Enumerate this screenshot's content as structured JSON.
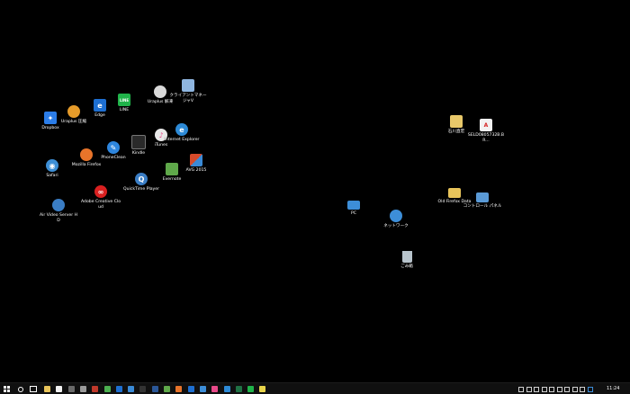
{
  "desktop": {
    "icons": [
      {
        "label": "Dropbox",
        "icon": "dropbox-icon",
        "color": "#2b7de9"
      },
      {
        "label": "Uraplus 圧縮",
        "icon": "uraplus-compress-icon",
        "color": "#e59b2a"
      },
      {
        "label": "Edge",
        "icon": "edge-icon",
        "color": "#1e6fd1"
      },
      {
        "label": "LINE",
        "icon": "line-icon",
        "color": "#20b34a"
      },
      {
        "label": "Uraplus 解凍",
        "icon": "uraplus-extract-icon",
        "color": "#d9d9d9"
      },
      {
        "label": "クライアントマネージャV",
        "icon": "client-manager-icon",
        "color": "#8fb6e0"
      },
      {
        "label": "Safari",
        "icon": "safari-icon",
        "color": "#3d8fd6"
      },
      {
        "label": "Mozilla Firefox",
        "icon": "firefox-icon",
        "color": "#e8742a"
      },
      {
        "label": "PhoneClean",
        "icon": "phoneclean-icon",
        "color": "#2e86de"
      },
      {
        "label": "Kindle",
        "icon": "kindle-icon",
        "color": "#2a2a2a"
      },
      {
        "label": "iTunes",
        "icon": "itunes-icon",
        "color": "#e8e8e8"
      },
      {
        "label": "Internet Explorer",
        "icon": "internet-explorer-icon",
        "color": "#2d8ad6"
      },
      {
        "label": "Evernote",
        "icon": "evernote-icon",
        "color": "#5fa84a"
      },
      {
        "label": "AVG 2015",
        "icon": "avg-icon",
        "color": "#d64a2a"
      },
      {
        "label": "Adobe Creative Cloud",
        "icon": "adobe-creative-cloud-icon",
        "color": "#d92020"
      },
      {
        "label": "QuickTime Player",
        "icon": "quicktime-icon",
        "color": "#3a7dc4"
      },
      {
        "label": "Air Video Server HD",
        "icon": "air-video-server-icon",
        "color": "#3a7dc4"
      },
      {
        "label": "石川直宏",
        "icon": "user-folder-icon",
        "color": "#e8c86a"
      },
      {
        "label": "SELD0805732B.BR...",
        "icon": "pdf-file-icon",
        "color": "#d62828"
      },
      {
        "label": "PC",
        "icon": "this-pc-icon",
        "color": "#3d8ed8"
      },
      {
        "label": "Old Firefox Data",
        "icon": "folder-icon",
        "color": "#e8c45a"
      },
      {
        "label": "コントロール パネル",
        "icon": "control-panel-icon",
        "color": "#5a9ad6"
      },
      {
        "label": "ネットワーク",
        "icon": "network-icon",
        "color": "#3d8ed8"
      },
      {
        "label": "ごみ箱",
        "icon": "recycle-bin-icon",
        "color": "#b8c4cc"
      }
    ]
  },
  "taskbar": {
    "start_icon": "windows-start-icon",
    "search_icon": "search-icon",
    "taskview_icon": "task-view-icon",
    "pinned": [
      {
        "icon": "file-explorer-icon",
        "color": "#e8c45a"
      },
      {
        "icon": "store-icon",
        "color": "#f2f2f2"
      },
      {
        "icon": "calculator-icon",
        "color": "#6a6a6a"
      },
      {
        "icon": "settings-icon",
        "color": "#9a9a9a"
      },
      {
        "icon": "app-red-icon",
        "color": "#c0392b"
      },
      {
        "icon": "chrome-icon",
        "color": "#4caf50"
      },
      {
        "icon": "outlook-icon",
        "color": "#1e6fd1"
      },
      {
        "icon": "mail-icon",
        "color": "#3a8ad6"
      },
      {
        "icon": "terminal-icon",
        "color": "#333333"
      },
      {
        "icon": "word-icon",
        "color": "#2b5797"
      },
      {
        "icon": "evernote-icon",
        "color": "#5fa84a"
      },
      {
        "icon": "firefox-icon",
        "color": "#e8742a"
      },
      {
        "icon": "edge-icon",
        "color": "#1e6fd1"
      },
      {
        "icon": "app-blue-icon",
        "color": "#3d8ed8"
      },
      {
        "icon": "itunes-icon",
        "color": "#e84a8a"
      },
      {
        "icon": "photos-icon",
        "color": "#2d8ad6"
      },
      {
        "icon": "excel-icon",
        "color": "#207245"
      },
      {
        "icon": "line-icon",
        "color": "#20b34a"
      },
      {
        "icon": "notes-icon",
        "color": "#e8d44a"
      }
    ],
    "tray": [
      {
        "icon": "chevron-up-icon",
        "color": "#d0d0d0"
      },
      {
        "icon": "dropbox-tray-icon",
        "color": "#d0d0d0"
      },
      {
        "icon": "onedrive-icon",
        "color": "#d0d0d0"
      },
      {
        "icon": "network-tray-icon",
        "color": "#d0d0d0"
      },
      {
        "icon": "power-icon",
        "color": "#d0d0d0"
      },
      {
        "icon": "volume-icon",
        "color": "#d0d0d0"
      },
      {
        "icon": "keyboard-icon",
        "color": "#d0d0d0"
      },
      {
        "icon": "notification-icon",
        "color": "#d0d0d0"
      },
      {
        "icon": "ime-icon",
        "color": "#d0d0d0"
      },
      {
        "icon": "security-icon",
        "color": "#3d8ed8"
      }
    ],
    "clock": "11:24"
  }
}
